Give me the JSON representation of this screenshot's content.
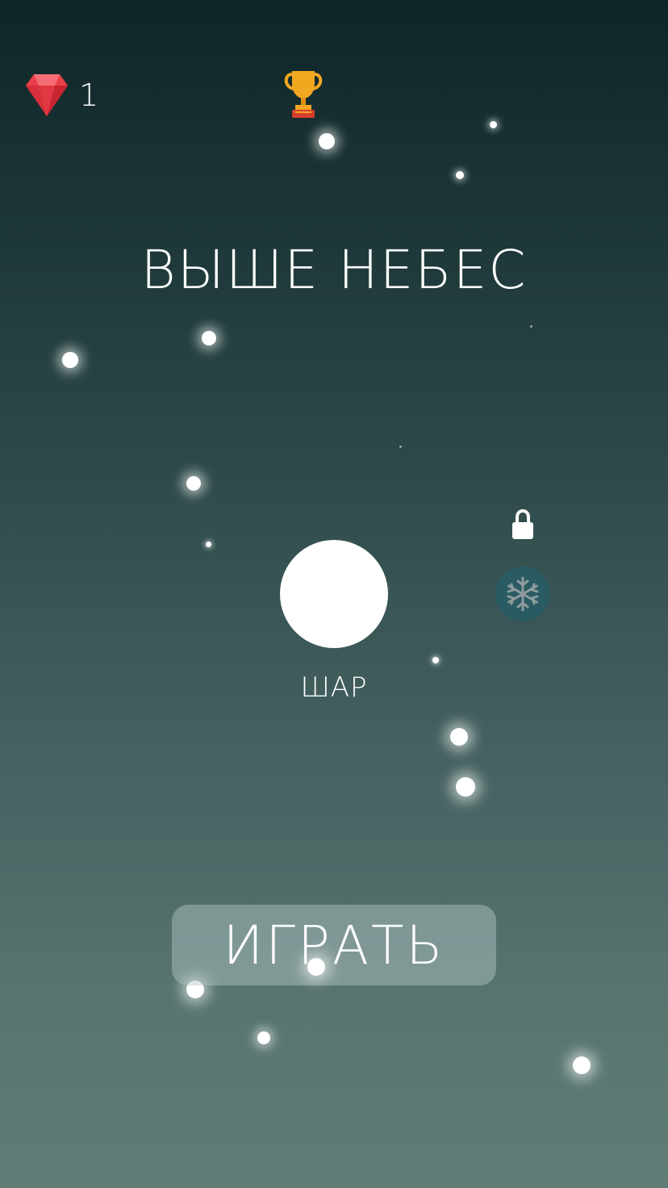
{
  "hud": {
    "gem_count": "1",
    "gem_icon": "ruby-gem-icon",
    "trophy_icon": "trophy-icon"
  },
  "title": "ВЫШЕ НЕБЕС",
  "selector": {
    "current_label": "ШАР",
    "next_locked": true,
    "next_icon": "snowflake-icon"
  },
  "play_button": {
    "label": "ИГРАТЬ"
  },
  "colors": {
    "gem": "#e8404a",
    "trophy": "#f2a720",
    "snow_button": "#2a5b63",
    "bg_top": "#0f2526",
    "bg_bottom": "#5f7d76"
  }
}
